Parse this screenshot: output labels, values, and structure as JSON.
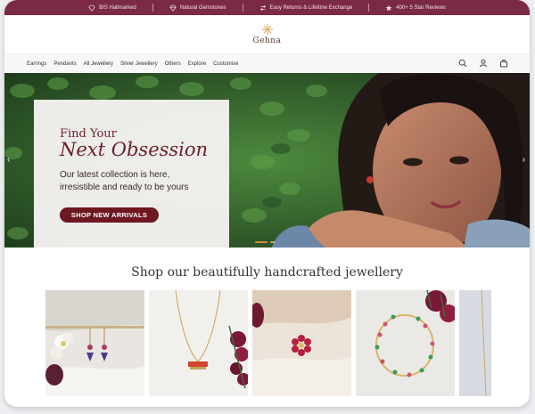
{
  "topbar": {
    "items": [
      {
        "label": "BIS Hallmarked",
        "icon": "diamond-icon"
      },
      {
        "label": "Natural Gemstones",
        "icon": "gem-icon"
      },
      {
        "label": "Easy Returns & Lifetime Exchange",
        "icon": "exchange-icon"
      },
      {
        "label": "400+ 5 Star Reviews",
        "icon": "star-icon"
      }
    ],
    "color": "#7b2a45"
  },
  "header": {
    "logo_text": "Gehna",
    "logo_icon": "sunburst-icon"
  },
  "nav": {
    "items": [
      "Earrings",
      "Pendants",
      "All Jewellery",
      "Silver Jewellery",
      "Others",
      "Explore",
      "Customise"
    ],
    "icons": [
      "search-icon",
      "user-icon",
      "bag-icon"
    ]
  },
  "hero": {
    "line1": "Find Your",
    "line2": "Next Obsession",
    "desc1": "Our latest collection is here,",
    "desc2": "irresistible and ready to be yours",
    "button": "SHOP NEW ARRIVALS",
    "prev_icon": "chevron-left-icon",
    "next_icon": "chevron-right-icon",
    "accent": "#6e1720"
  },
  "section": {
    "title": "Shop our beautifully handcrafted jewellery"
  },
  "products": [
    {
      "icon": "drop-earrings-image"
    },
    {
      "icon": "pendant-necklace-image"
    },
    {
      "icon": "flower-stud-image"
    },
    {
      "icon": "bracelet-image"
    },
    {
      "icon": "partial-product-image"
    }
  ]
}
